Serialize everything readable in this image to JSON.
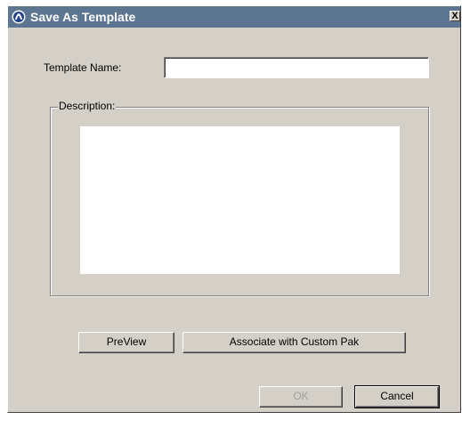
{
  "window": {
    "title": "Save As Template",
    "close_label": "X"
  },
  "form": {
    "template_name_label": "Template Name:",
    "template_name_value": "",
    "description_label": "Description:",
    "description_value": ""
  },
  "buttons": {
    "preview": "PreView",
    "associate": "Associate with Custom  Pak",
    "ok": "OK",
    "cancel": "Cancel"
  },
  "states": {
    "ok_enabled": false
  },
  "colors": {
    "titlebar": "#5c7691",
    "dialog_bg": "#d4d0c8"
  },
  "icons": {
    "app": "app-logo-icon",
    "close": "close-icon"
  }
}
